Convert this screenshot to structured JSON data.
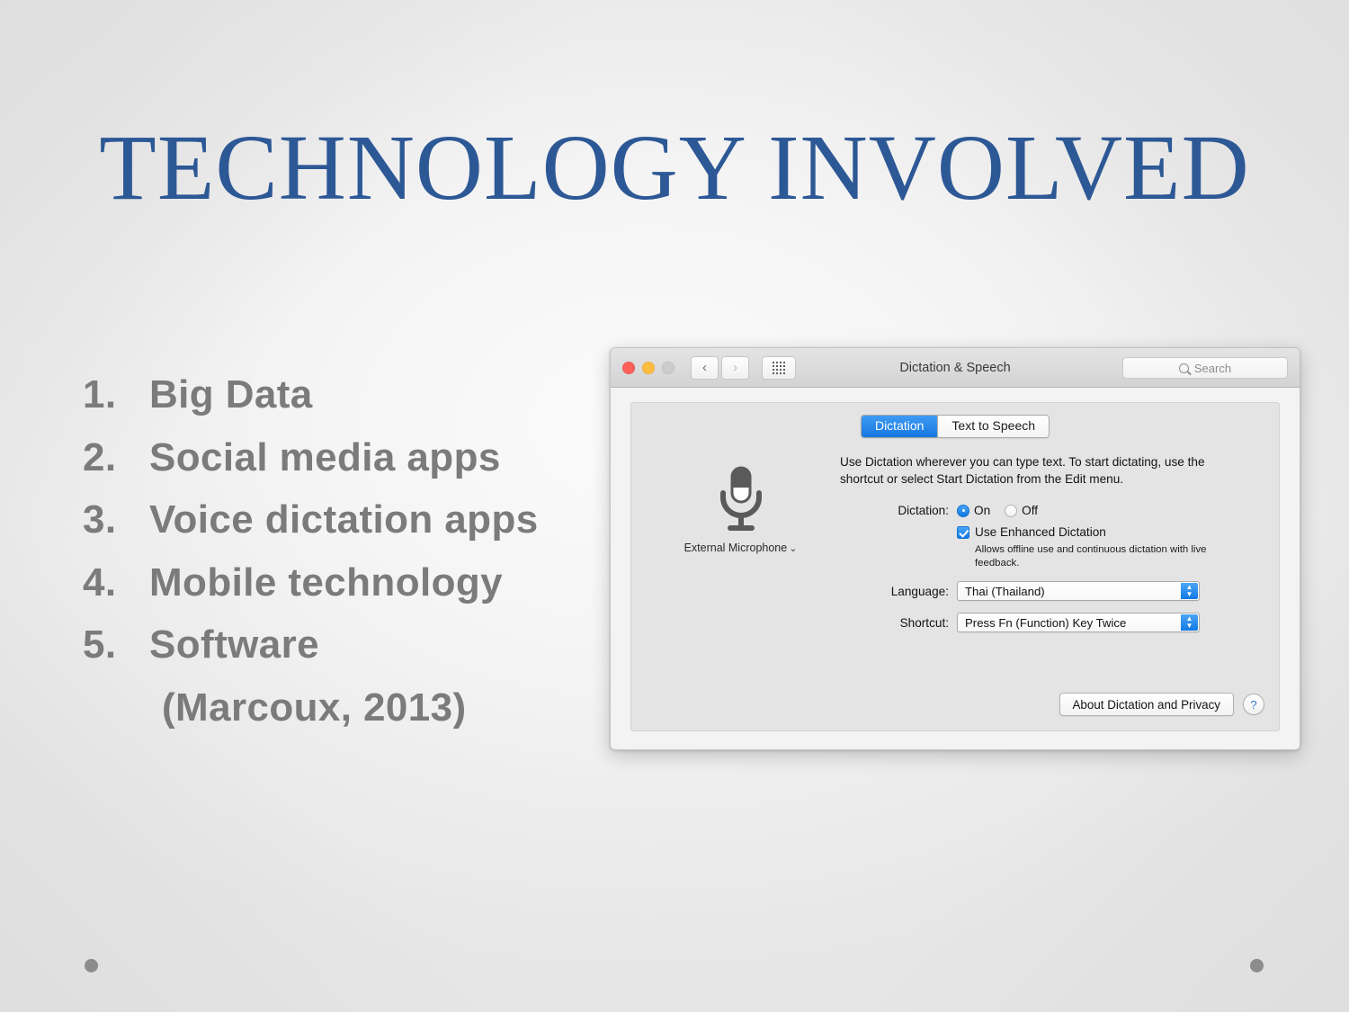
{
  "slide": {
    "title": "TECHNOLOGY INVOLVED",
    "title_color": "#2d5896",
    "body_color": "#7b7b7b",
    "bullets": [
      {
        "num": "1.",
        "text": "Big Data"
      },
      {
        "num": "2.",
        "text": "Social media apps"
      },
      {
        "num": "3.",
        "text": "Voice dictation apps"
      },
      {
        "num": "4.",
        "text": "Mobile technology"
      },
      {
        "num": "5.",
        "text": "Software"
      }
    ],
    "citation": "(Marcoux, 2013)"
  },
  "window": {
    "title": "Dictation & Speech",
    "traffic_lights": {
      "close": "close-button",
      "minimize": "minimize-button",
      "zoom": "zoom-button"
    },
    "nav": {
      "back": "‹",
      "forward": "›",
      "grid": "show-all-icon"
    },
    "search": {
      "placeholder": "Search",
      "icon": "search-icon"
    },
    "tabs": [
      {
        "label": "Dictation",
        "active": true
      },
      {
        "label": "Text to Speech",
        "active": false
      }
    ],
    "microphone": {
      "icon": "microphone-icon",
      "label": "External Microphone",
      "chevron": "⌄"
    },
    "intro": "Use Dictation wherever you can type text. To start dictating, use the shortcut or select Start Dictation from the Edit menu.",
    "dictation": {
      "label": "Dictation:",
      "options": [
        {
          "label": "On",
          "selected": true
        },
        {
          "label": "Off",
          "selected": false
        }
      ]
    },
    "enhanced": {
      "label": "Use Enhanced Dictation",
      "checked": true,
      "description": "Allows offline use and continuous dictation with live feedback."
    },
    "language": {
      "label": "Language:",
      "value": "Thai (Thailand)"
    },
    "shortcut": {
      "label": "Shortcut:",
      "value": "Press Fn (Function) Key Twice"
    },
    "about_button": "About Dictation and Privacy",
    "help_button": "?",
    "accent_color": "#1179e3"
  }
}
